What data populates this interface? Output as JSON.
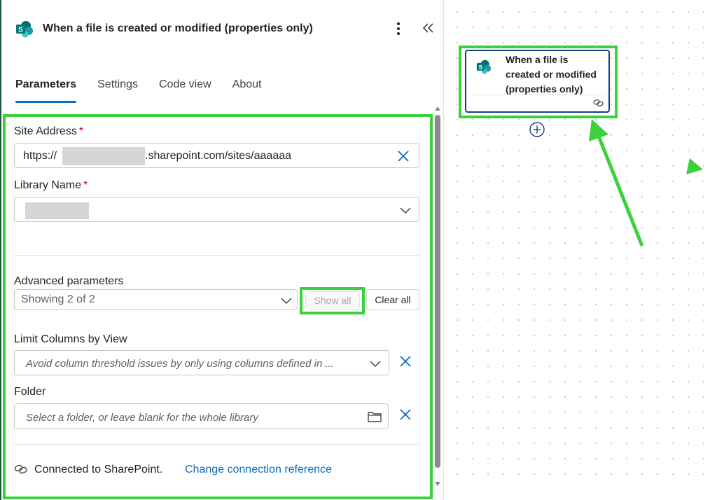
{
  "header": {
    "title": "When a file is created or modified (properties only)"
  },
  "tabs": [
    {
      "label": "Parameters"
    },
    {
      "label": "Settings"
    },
    {
      "label": "Code view"
    },
    {
      "label": "About"
    }
  ],
  "fields": {
    "site_address": {
      "label": "Site Address",
      "required_mark": "*",
      "value_prefix": "https://",
      "value_suffix": ".sharepoint.com/sites/aaaaaa"
    },
    "library_name": {
      "label": "Library Name",
      "required_mark": "*"
    },
    "advanced": {
      "label": "Advanced parameters",
      "value": "Showing 2 of 2",
      "show_all_label": "Show all",
      "clear_all_label": "Clear all"
    },
    "limit_columns": {
      "label": "Limit Columns by View",
      "placeholder": "Avoid column threshold issues by only using columns defined in ..."
    },
    "folder": {
      "label": "Folder",
      "placeholder": "Select a folder, or leave blank for the whole library"
    }
  },
  "connection": {
    "status": "Connected to SharePoint.",
    "change_link": "Change connection reference"
  },
  "canvas": {
    "card_title": "When a file is created or modified (properties only)"
  },
  "colors": {
    "accent": "#0f6cbd",
    "highlight": "#3ad13a",
    "required": "#c50f1f",
    "sharepoint_teal": "#038387",
    "card_border": "#1a3b7c"
  },
  "icons": {
    "header": "sharepoint-icon",
    "more": "more-vertical-icon",
    "collapse": "double-chevron-left-icon",
    "clear": "close-icon",
    "dropdown": "chevron-down-icon",
    "folder": "folder-icon",
    "connection": "link-icon",
    "add": "plus-circle-icon"
  }
}
